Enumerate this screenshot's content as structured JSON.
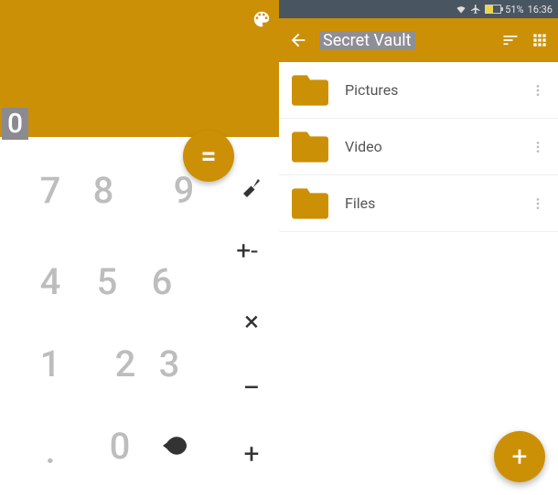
{
  "calculator": {
    "display_value": "0",
    "equals_label": "=",
    "keys": {
      "k7": "7",
      "k8": "8",
      "k9": "9",
      "k4": "4",
      "k5": "5",
      "k6": "6",
      "k1": "1",
      "k2": "2",
      "k3": "3",
      "kdot": ".",
      "k0": "0"
    },
    "ops": {
      "plusminus": "+-",
      "multiply": "×",
      "subtract": "−",
      "add": "+"
    }
  },
  "statusbar": {
    "battery_pct": "51%",
    "time": "16:36"
  },
  "vault": {
    "title": "Secret Vault",
    "folders": [
      {
        "label": "Pictures"
      },
      {
        "label": "Video"
      },
      {
        "label": "Files"
      }
    ],
    "fab_label": "+"
  }
}
